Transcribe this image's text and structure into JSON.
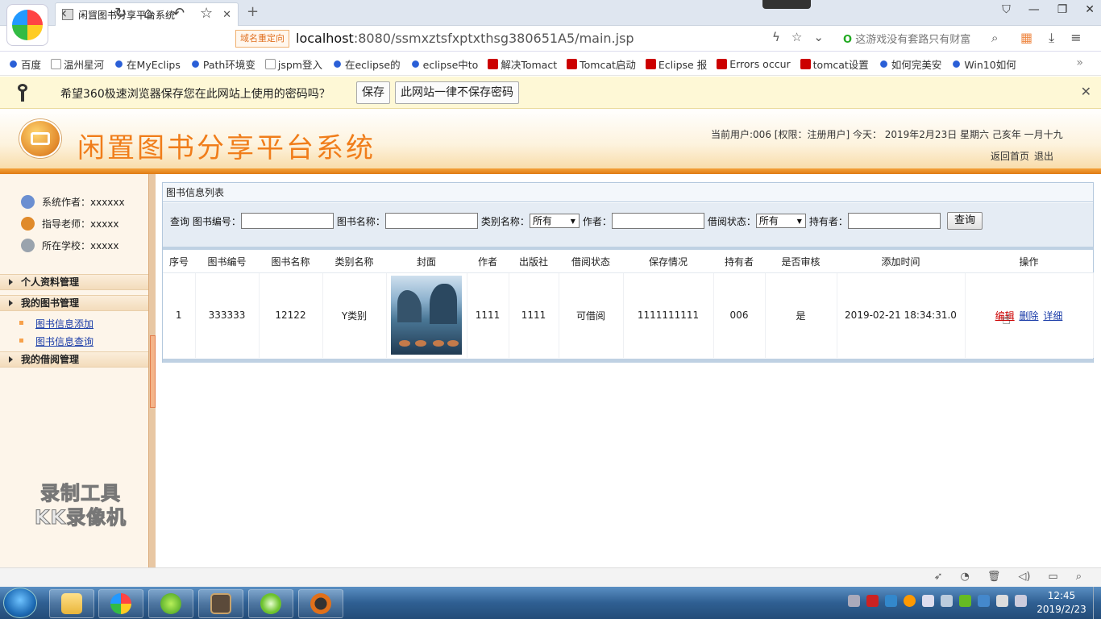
{
  "browser": {
    "tab_title": "闲置图书分享平台系统",
    "new_tab": "+",
    "tab_close": "✕",
    "redirect_badge": "域名重定向",
    "url_host": "localhost",
    "url_rest": ":8080/ssmxztsfxptxthsg380651A5/main.jsp",
    "search_text": "这游戏没有套路只有财富",
    "search_logo": "O"
  },
  "bookmarks": [
    {
      "label": "百度",
      "icon": "paw"
    },
    {
      "label": "温州星河",
      "icon": "doc"
    },
    {
      "label": "在MyEclips",
      "icon": "paw"
    },
    {
      "label": "Path环境变",
      "icon": "paw"
    },
    {
      "label": "jspm登入",
      "icon": "doc"
    },
    {
      "label": "在eclipse的",
      "icon": "paw"
    },
    {
      "label": "eclipse中to",
      "icon": "paw"
    },
    {
      "label": "解决Tomact",
      "icon": "csdn"
    },
    {
      "label": "Tomcat启动",
      "icon": "csdn"
    },
    {
      "label": "Eclipse 报",
      "icon": "csdn"
    },
    {
      "label": "Errors occur",
      "icon": "csdn"
    },
    {
      "label": "tomcat设置",
      "icon": "csdn"
    },
    {
      "label": "如何完美安",
      "icon": "paw"
    },
    {
      "label": "Win10如何",
      "icon": "paw"
    }
  ],
  "bookmarks_more": "»",
  "password_bar": {
    "message": "希望360极速浏览器保存您在此网站上使用的密码吗？",
    "save": "保存",
    "never": "此网站一律不保存密码",
    "close": "✕"
  },
  "site": {
    "title": "闲置图书分享平台系统",
    "user_info": "当前用户:006 [权限：注册用户] 今天： 2019年2月23日 星期六 己亥年 一月十九",
    "home_link": "返回首页",
    "logout_link": "退出"
  },
  "sidebar": {
    "info": [
      {
        "label": "系统作者：xxxxxx",
        "color": "#6b8fd1"
      },
      {
        "label": "指导老师：xxxxx",
        "color": "#e08a2a"
      },
      {
        "label": "所在学校：xxxxx",
        "color": "#9aa3ad"
      }
    ],
    "sections": {
      "personal": "个人资料管理",
      "books": "我的图书管理",
      "book_add": "图书信息添加",
      "book_query": "图书信息查询",
      "borrow": "我的借阅管理"
    }
  },
  "watermark": {
    "line1": "录制工具",
    "line2": "KK录像机"
  },
  "content": {
    "panel_title": "图书信息列表",
    "query": {
      "label": "查询",
      "book_no": "图书编号：",
      "book_name": "图书名称：",
      "category": "类别名称：",
      "category_value": "所有",
      "author": "作者：",
      "status": "借阅状态：",
      "status_value": "所有",
      "holder": "持有者：",
      "button": "查询"
    },
    "columns": [
      "序号",
      "图书编号",
      "图书名称",
      "类别名称",
      "封面",
      "作者",
      "出版社",
      "借阅状态",
      "保存情况",
      "持有者",
      "是否审核",
      "添加时间",
      "操作"
    ],
    "rows": [
      {
        "no": "1",
        "book_no": "333333",
        "name": "12122",
        "category": "Y类别",
        "author": "1111",
        "publisher": "1111",
        "status": "可借阅",
        "condition": "1111111111",
        "holder": "006",
        "reviewed": "是",
        "added": "2019-02-21 18:34:31.0",
        "edit": "编辑",
        "delete": "删除",
        "detail": "详细"
      }
    ]
  },
  "taskbar": {
    "time": "12:45",
    "date": "2019/2/23"
  }
}
